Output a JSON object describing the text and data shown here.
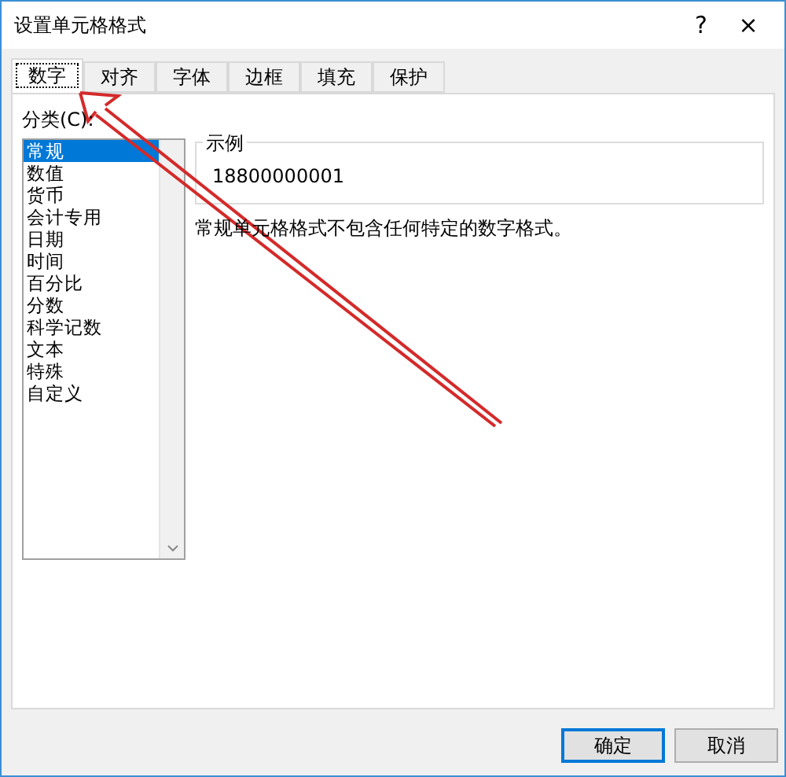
{
  "window": {
    "title": "设置单元格格式",
    "help": "?",
    "close": "×"
  },
  "tabs": [
    {
      "label": "数字",
      "selected": true
    },
    {
      "label": "对齐",
      "selected": false
    },
    {
      "label": "字体",
      "selected": false
    },
    {
      "label": "边框",
      "selected": false
    },
    {
      "label": "填充",
      "selected": false
    },
    {
      "label": "保护",
      "selected": false
    }
  ],
  "category": {
    "label": "分类(C):",
    "items": [
      {
        "label": "常规",
        "selected": true
      },
      {
        "label": "数值",
        "selected": false
      },
      {
        "label": "货币",
        "selected": false
      },
      {
        "label": "会计专用",
        "selected": false
      },
      {
        "label": "日期",
        "selected": false
      },
      {
        "label": "时间",
        "selected": false
      },
      {
        "label": "百分比",
        "selected": false
      },
      {
        "label": "分数",
        "selected": false
      },
      {
        "label": "科学记数",
        "selected": false
      },
      {
        "label": "文本",
        "selected": false
      },
      {
        "label": "特殊",
        "selected": false
      },
      {
        "label": "自定义",
        "selected": false
      }
    ]
  },
  "sample": {
    "label": "示例",
    "value": "18800000001"
  },
  "description": "常规单元格格式不包含任何特定的数字格式。",
  "buttons": [
    {
      "label": "确定",
      "selected": true
    },
    {
      "label": "取消",
      "selected": false
    }
  ]
}
